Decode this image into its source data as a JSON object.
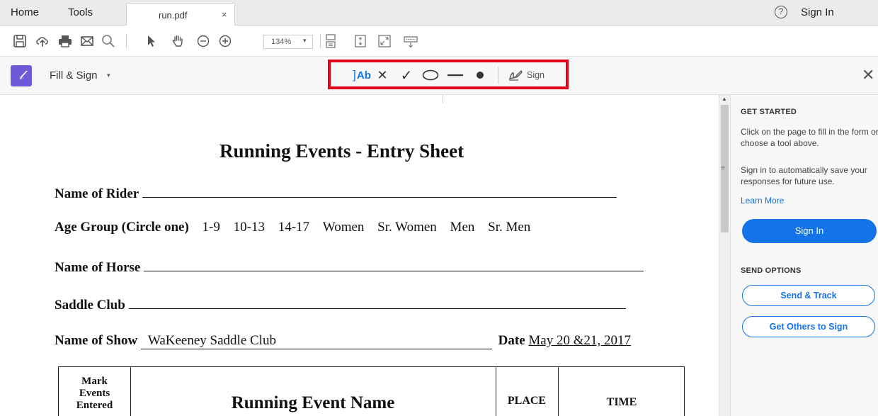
{
  "tabbar": {
    "home": "Home",
    "tools": "Tools",
    "tab_label": "run.pdf",
    "tab_close": "×",
    "help": "?",
    "sign_in": "Sign In"
  },
  "toolbar": {
    "zoom_value": "134%",
    "zoom_caret": "▾"
  },
  "fillsign": {
    "logo": "𝓁",
    "title": "Fill & Sign",
    "caret": "▾",
    "tool_text": "Ab",
    "tool_cross": "✕",
    "tool_check": "✓",
    "tool_sign_label": "Sign",
    "close": "✕"
  },
  "document": {
    "title": "Running Events - Entry Sheet",
    "rider_label": "Name of Rider",
    "age_label": "Age Group (Circle one)",
    "age_groups": [
      "1-9",
      "10-13",
      "14-17",
      "Women",
      "Sr. Women",
      "Men",
      "Sr. Men"
    ],
    "horse_label": "Name of Horse",
    "club_label": "Saddle Club",
    "show_label": "Name of Show",
    "show_value": "WaKeeney Saddle Club",
    "date_label": "Date",
    "date_value": "May 20 &21, 2017",
    "table_headers": {
      "mark": "Mark\nEvents\nEntered",
      "event": "Running Event Name",
      "place": "PLACE",
      "time": "TIME"
    }
  },
  "panel": {
    "get_started_heading": "GET STARTED",
    "get_started_text": "Click on the page to fill in the form or choose a tool above.",
    "signin_text": "Sign in to automatically save your responses for future use.",
    "learn_more": "Learn More",
    "sign_in_button": "Sign In",
    "send_heading": "SEND OPTIONS",
    "send_track": "Send & Track",
    "get_others": "Get Others to Sign"
  },
  "colors": {
    "accent": "#1473e6",
    "highlight": "#e3001b",
    "fillsign_logo": "#6d5ad8"
  }
}
